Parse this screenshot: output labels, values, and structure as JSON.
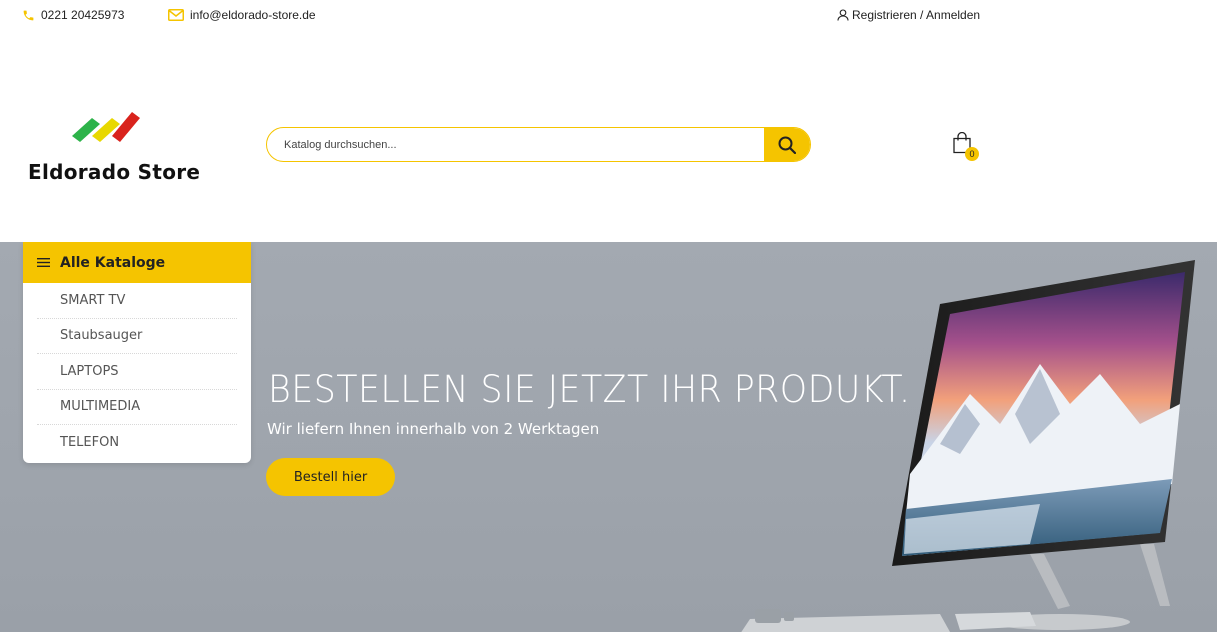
{
  "topbar": {
    "phone": "0221 20425973",
    "email": "info@eldorado-store.de",
    "account": "Registrieren / Anmelden",
    "phone_icon": "phone-icon",
    "mail_icon": "mail-icon",
    "user_icon": "user-icon"
  },
  "header": {
    "logo_text": "Eldorado Store",
    "search_placeholder": "Katalog durchsuchen...",
    "search_icon": "search-icon",
    "cart_icon": "shopping-bag-icon",
    "cart_count": "0"
  },
  "categories": {
    "title": "Alle Kataloge",
    "items": [
      "SMART TV",
      "Staubsauger",
      "LAPTOPS",
      "MULTIMEDIA",
      "TELEFON"
    ]
  },
  "hero": {
    "title": "BESTELLEN SIE JETZT IHR PRODUKT.",
    "subtitle": "Wir liefern Ihnen innerhalb von 2 Werktagen",
    "button": "Bestell hier"
  },
  "colors": {
    "accent": "#f5c400",
    "hero_bg": "#a0a6ae"
  }
}
